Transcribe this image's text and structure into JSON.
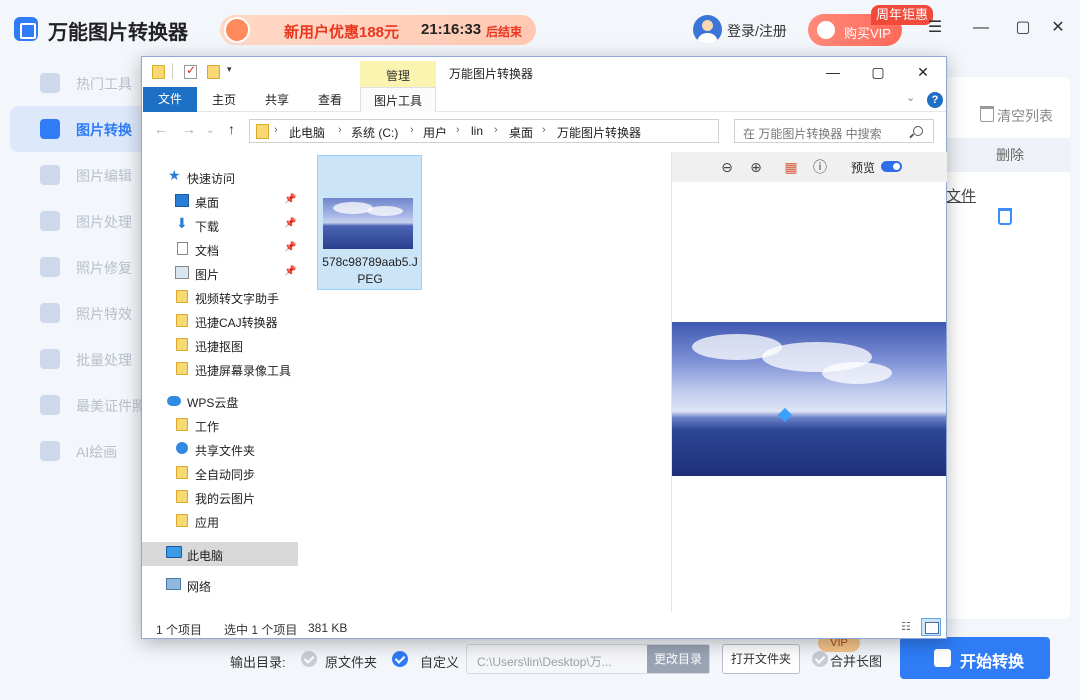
{
  "app": {
    "title": "万能图片转换器",
    "promo_text": "新用户优惠188元",
    "promo_time": "21:16:33",
    "promo_suffix": "后结束",
    "login": "登录/注册",
    "vip_button": "购买VIP",
    "anniversary_badge": "周年钜惠",
    "window_controls": [
      "menu-icon",
      "minimize-icon",
      "maximize-icon",
      "close-icon"
    ]
  },
  "sidebar": {
    "items": [
      {
        "label": "热门工具",
        "icon": "fire-icon",
        "active": false
      },
      {
        "label": "图片转换",
        "icon": "image-convert-icon",
        "active": true
      },
      {
        "label": "图片编辑",
        "icon": "image-edit-icon",
        "active": false
      },
      {
        "label": "图片处理",
        "icon": "image-process-icon",
        "active": false
      },
      {
        "label": "照片修复",
        "icon": "photo-repair-icon",
        "active": false
      },
      {
        "label": "照片特效",
        "icon": "photo-effect-icon",
        "active": false
      },
      {
        "label": "批量处理",
        "icon": "batch-icon",
        "active": false
      },
      {
        "label": "最美证件照",
        "icon": "id-photo-icon",
        "active": false
      },
      {
        "label": "AI绘画",
        "icon": "ai-paint-icon",
        "active": false
      }
    ]
  },
  "main": {
    "clear_list": "清空列表",
    "column_delete": "删除",
    "file_link_fragment": "文件"
  },
  "bottom": {
    "output_label": "输出目录:",
    "original_folder": "原文件夹",
    "custom": "自定义",
    "path": "C:\\Users\\lin\\Desktop\\万...",
    "change_dir": "更改目录",
    "open_folder": "打开文件夹",
    "vip_badge": "VIP",
    "merge_long": "合并长图",
    "start": "开始转换"
  },
  "dialog": {
    "manage_tab": "管理",
    "title": "万能图片转换器",
    "ribbon_tabs": [
      "文件",
      "主页",
      "共享",
      "查看",
      "图片工具"
    ],
    "breadcrumb": [
      "此电脑",
      "系统 (C:)",
      "用户",
      "lin",
      "桌面",
      "万能图片转换器"
    ],
    "search_placeholder": "在 万能图片转换器 中搜索",
    "nav": {
      "quick_access": "快速访问",
      "quick_items": [
        "桌面",
        "下载",
        "文档",
        "图片",
        "视频转文字助手",
        "迅捷CAJ转换器",
        "迅捷抠图",
        "迅捷屏幕录像工具"
      ],
      "wps_cloud": "WPS云盘",
      "wps_items": [
        "工作",
        "共享文件夹",
        "全自动同步",
        "我的云图片",
        "应用"
      ],
      "this_pc": "此电脑",
      "network": "网络"
    },
    "file": {
      "name": "578c98789aab5.JPEG"
    },
    "preview_label": "预览",
    "status": {
      "count": "1 个项目",
      "selected": "选中 1 个项目",
      "size": "381 KB"
    }
  }
}
